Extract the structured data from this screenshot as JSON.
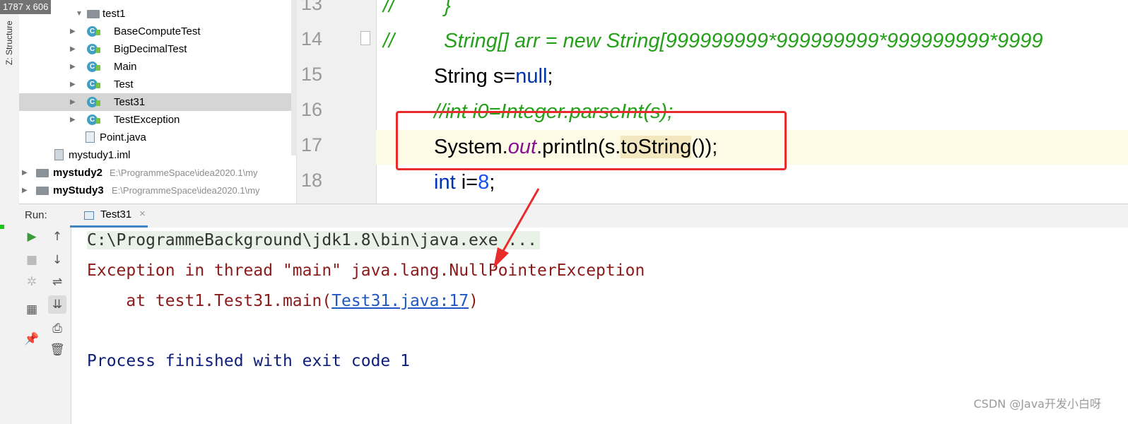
{
  "size_label": "1787 x 606",
  "structure_label": "Z: Structure",
  "tree": {
    "items": [
      {
        "label": "test1",
        "type": "folder"
      },
      {
        "label": "BaseComputeTest",
        "type": "class"
      },
      {
        "label": "BigDecimalTest",
        "type": "class"
      },
      {
        "label": "Main",
        "type": "class"
      },
      {
        "label": "Test",
        "type": "class"
      },
      {
        "label": "Test31",
        "type": "class",
        "selected": true
      },
      {
        "label": "TestException",
        "type": "class"
      },
      {
        "label": "Point.java",
        "type": "file"
      },
      {
        "label": "mystudy1.iml",
        "type": "iml"
      },
      {
        "label": "mystudy2",
        "type": "module",
        "path": "E:\\ProgrammeSpace\\idea2020.1\\my"
      },
      {
        "label": "myStudy3",
        "type": "module",
        "path": "E:\\ProgrammeSpace\\idea2020.1\\my"
      }
    ]
  },
  "editor": {
    "line_numbers": [
      "13",
      "14",
      "15",
      "16",
      "17",
      "18"
    ],
    "lines": {
      "l13": {
        "prefix": "//",
        "text": "}"
      },
      "l14": {
        "prefix": "//",
        "text": "String[] arr = new String[999999999*999999999*999999999*9999"
      },
      "l15": {
        "type": "String",
        "var": " s=",
        "kw": "null",
        "end": ";"
      },
      "l16": {
        "text": "//int i0=Integer.parseInt(s);"
      },
      "l17": {
        "a": "System.",
        "field": "out",
        "b": ".println(s.",
        "hl": "toString",
        "c": "());"
      },
      "l18": {
        "kw": "int",
        "mid": " i=",
        "num": "8",
        "end": ";"
      }
    }
  },
  "run": {
    "label": "Run:",
    "tab_label": "Test31",
    "tab_close": "×",
    "console": {
      "cmd": "C:\\ProgrammeBackground\\jdk1.8\\bin\\java.exe ...",
      "err1": "Exception in thread \"main\" java.lang.NullPointerException",
      "err2_prefix": "    at test1.Test31.main(",
      "err2_link": "Test31.java:17",
      "err2_suffix": ")",
      "done": "Process finished with exit code 1"
    }
  },
  "watermark": "CSDN @Java开发小白呀",
  "colors": {
    "accent": "#4083c9",
    "error_text": "#8b1a1a",
    "annotation_red": "#ea2b2b",
    "comment_green": "#24a019"
  },
  "icons": {
    "run": "play-icon",
    "stop": "stop-icon",
    "up": "arrow-up-icon",
    "down": "arrow-down-icon",
    "wrap": "soft-wrap-icon",
    "scroll_end": "scroll-to-end-icon",
    "print": "print-icon",
    "delete": "trash-icon",
    "pin": "pin-icon",
    "layout": "layout-icon",
    "debug": "debug-icon"
  }
}
